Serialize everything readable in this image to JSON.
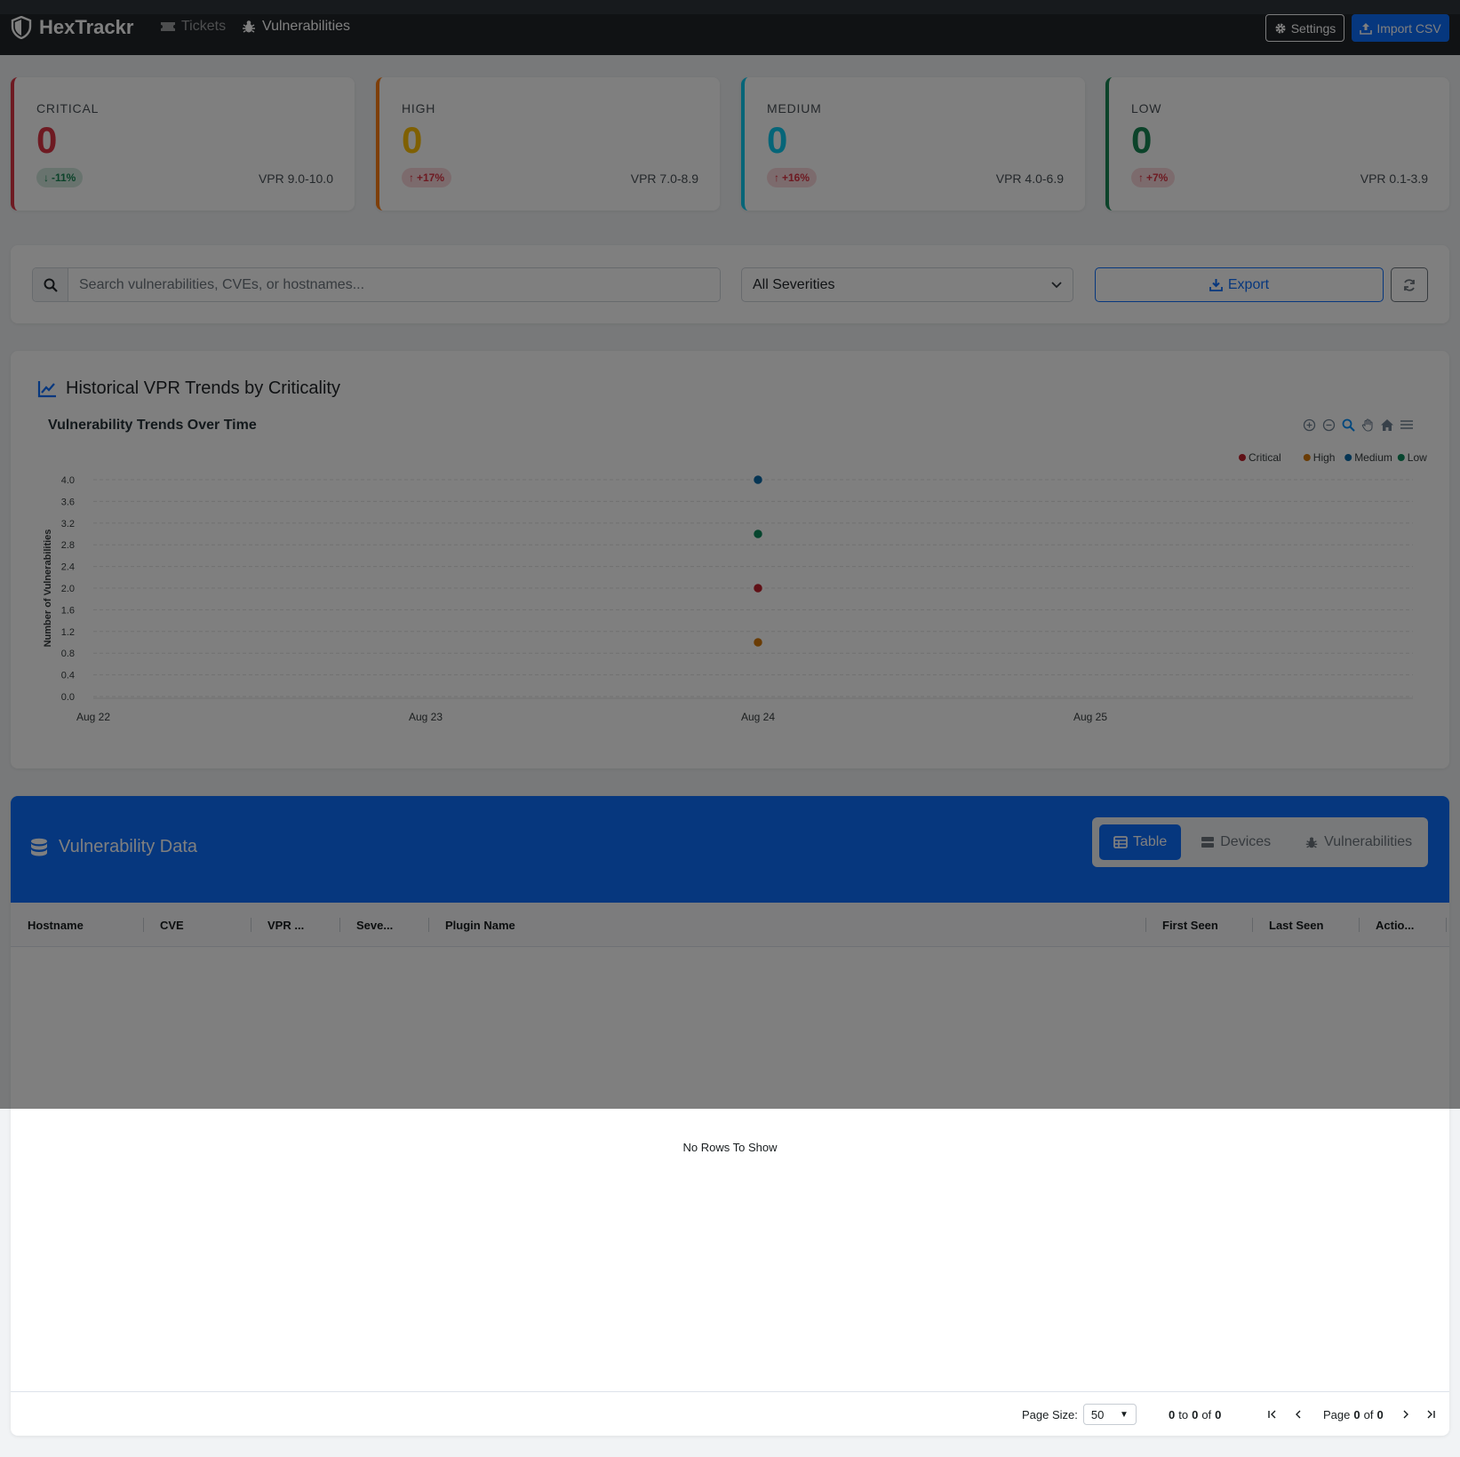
{
  "brand": {
    "name": "HexTrackr"
  },
  "nav": {
    "tickets": "Tickets",
    "vulnerabilities": "Vulnerabilities"
  },
  "header_buttons": {
    "settings": "Settings",
    "import_csv": "Import CSV"
  },
  "stats": [
    {
      "label": "CRITICAL",
      "value": "0",
      "trend": "-11%",
      "trend_dir": "down",
      "range": "VPR 9.0-10.0",
      "color": "#dc3545"
    },
    {
      "label": "HIGH",
      "value": "0",
      "trend": "+17%",
      "trend_dir": "up",
      "range": "VPR 7.0-8.9",
      "color": "#fd7e14"
    },
    {
      "label": "MEDIUM",
      "value": "0",
      "trend": "+16%",
      "trend_dir": "up",
      "range": "VPR 4.0-6.9",
      "color": "#0dcaf0"
    },
    {
      "label": "LOW",
      "value": "0",
      "trend": "+7%",
      "trend_dir": "up",
      "range": "VPR 0.1-3.9",
      "color": "#198754"
    }
  ],
  "filters": {
    "search_placeholder": "Search vulnerabilities, CVEs, or hostnames...",
    "severity_selected": "All Severities",
    "export_label": "Export"
  },
  "chart_section": {
    "heading": "Historical VPR Trends by Criticality"
  },
  "chart_data": {
    "type": "scatter",
    "title": "Vulnerability Trends Over Time",
    "xlabel": "",
    "ylabel": "Number of Vulnerabilities",
    "x_ticks": [
      "Aug 22",
      "Aug 23",
      "Aug 24",
      "Aug 25"
    ],
    "y_ticks": [
      "0.0",
      "0.4",
      "0.8",
      "1.2",
      "1.6",
      "2.0",
      "2.4",
      "2.8",
      "3.2",
      "3.6",
      "4.0"
    ],
    "ylim": [
      0,
      4
    ],
    "grid": true,
    "legend_position": "top-right",
    "series": [
      {
        "name": "Critical",
        "color": "#c0202d",
        "points": [
          {
            "x": "Aug 24",
            "y": 2
          }
        ]
      },
      {
        "name": "High",
        "color": "#d4780a",
        "points": [
          {
            "x": "Aug 24",
            "y": 1
          }
        ]
      },
      {
        "name": "Medium",
        "color": "#0a6ba8",
        "points": [
          {
            "x": "Aug 24",
            "y": 4
          }
        ]
      },
      {
        "name": "Low",
        "color": "#0c8a5c",
        "points": [
          {
            "x": "Aug 24",
            "y": 3
          }
        ]
      }
    ]
  },
  "data_section": {
    "title": "Vulnerability Data",
    "tabs": [
      {
        "label": "Table",
        "active": true,
        "icon": "table-icon"
      },
      {
        "label": "Devices",
        "active": false,
        "icon": "server-icon"
      },
      {
        "label": "Vulnerabilities",
        "active": false,
        "icon": "bug-icon"
      }
    ],
    "columns": [
      "Hostname",
      "CVE",
      "VPR ...",
      "Seve...",
      "Plugin Name",
      "First Seen",
      "Last Seen",
      "Actio..."
    ],
    "empty_message": "No Rows To Show",
    "pager": {
      "page_size_label": "Page Size:",
      "page_size": "50",
      "from": "0",
      "to_word": "to",
      "to": "0",
      "of_word": "of",
      "total": "0",
      "page_word": "Page",
      "page": "0",
      "pages_of": "of",
      "pages": "0"
    }
  }
}
